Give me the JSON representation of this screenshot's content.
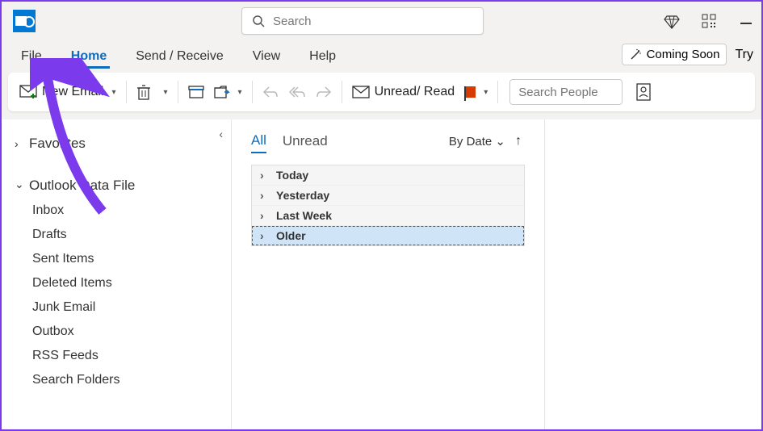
{
  "titlebar": {
    "search_placeholder": "Search"
  },
  "ribbon": {
    "tabs": {
      "file": "File",
      "home": "Home",
      "send_receive": "Send / Receive",
      "view": "View",
      "help": "Help"
    },
    "coming_soon": "Coming Soon",
    "try": "Try"
  },
  "toolbar": {
    "new_email": "New Email",
    "unread_read": "Unread/ Read",
    "search_people_placeholder": "Search People"
  },
  "nav": {
    "favorites": "Favorites",
    "data_file": "Outlook Data File",
    "folders": {
      "inbox": "Inbox",
      "drafts": "Drafts",
      "sent": "Sent Items",
      "deleted": "Deleted Items",
      "junk": "Junk Email",
      "outbox": "Outbox",
      "rss": "RSS Feeds",
      "search": "Search Folders"
    }
  },
  "list": {
    "tabs": {
      "all": "All",
      "unread": "Unread"
    },
    "sort_label": "By Date",
    "groups": {
      "today": "Today",
      "yesterday": "Yesterday",
      "last_week": "Last Week",
      "older": "Older"
    }
  }
}
